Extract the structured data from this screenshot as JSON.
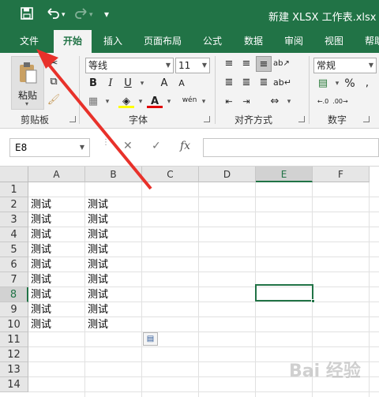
{
  "window": {
    "title": "新建 XLSX 工作表.xlsx"
  },
  "qat": {
    "save_icon": "save-icon",
    "undo_icon": "undo-icon",
    "redo_icon": "redo-icon",
    "customize": "▾"
  },
  "tabs": [
    "文件",
    "开始",
    "插入",
    "页面布局",
    "公式",
    "数据",
    "审阅",
    "视图",
    "帮助"
  ],
  "ribbon": {
    "clipboard": {
      "label": "剪贴板",
      "paste": "粘贴"
    },
    "font": {
      "label": "字体",
      "font_name": "等线",
      "font_size": "11",
      "bold": "B",
      "italic": "I",
      "underline": "U",
      "grow": "A",
      "shrink": "A",
      "phonetic": "wén"
    },
    "alignment": {
      "label": "对齐方式"
    },
    "number": {
      "label": "数字",
      "format": "常规",
      "percent": "%"
    }
  },
  "formula_bar": {
    "name_box": "E8",
    "cancel": "✕",
    "confirm": "✓",
    "fx": "fx",
    "value": ""
  },
  "sheet": {
    "columns": [
      "A",
      "B",
      "C",
      "D",
      "E",
      "F"
    ],
    "selected_column": "E",
    "rows": [
      "1",
      "2",
      "3",
      "4",
      "5",
      "6",
      "7",
      "8",
      "9",
      "10",
      "11",
      "12",
      "13",
      "14"
    ],
    "selected_row": "8",
    "cells": [
      {
        "row": 2,
        "a": "测试",
        "b": "测试"
      },
      {
        "row": 3,
        "a": "测试",
        "b": "测试"
      },
      {
        "row": 4,
        "a": "测试",
        "b": "测试"
      },
      {
        "row": 5,
        "a": "测试",
        "b": "测试"
      },
      {
        "row": 6,
        "a": "测试",
        "b": "测试"
      },
      {
        "row": 7,
        "a": "测试",
        "b": "测试"
      },
      {
        "row": 8,
        "a": "测试",
        "b": "测试"
      },
      {
        "row": 9,
        "a": "测试",
        "b": "测试"
      },
      {
        "row": 10,
        "a": "测试",
        "b": "测试"
      }
    ]
  },
  "watermark": "Bai 经验",
  "annotation": {
    "color": "#e8312a"
  },
  "theme": {
    "accent": "#217346"
  }
}
